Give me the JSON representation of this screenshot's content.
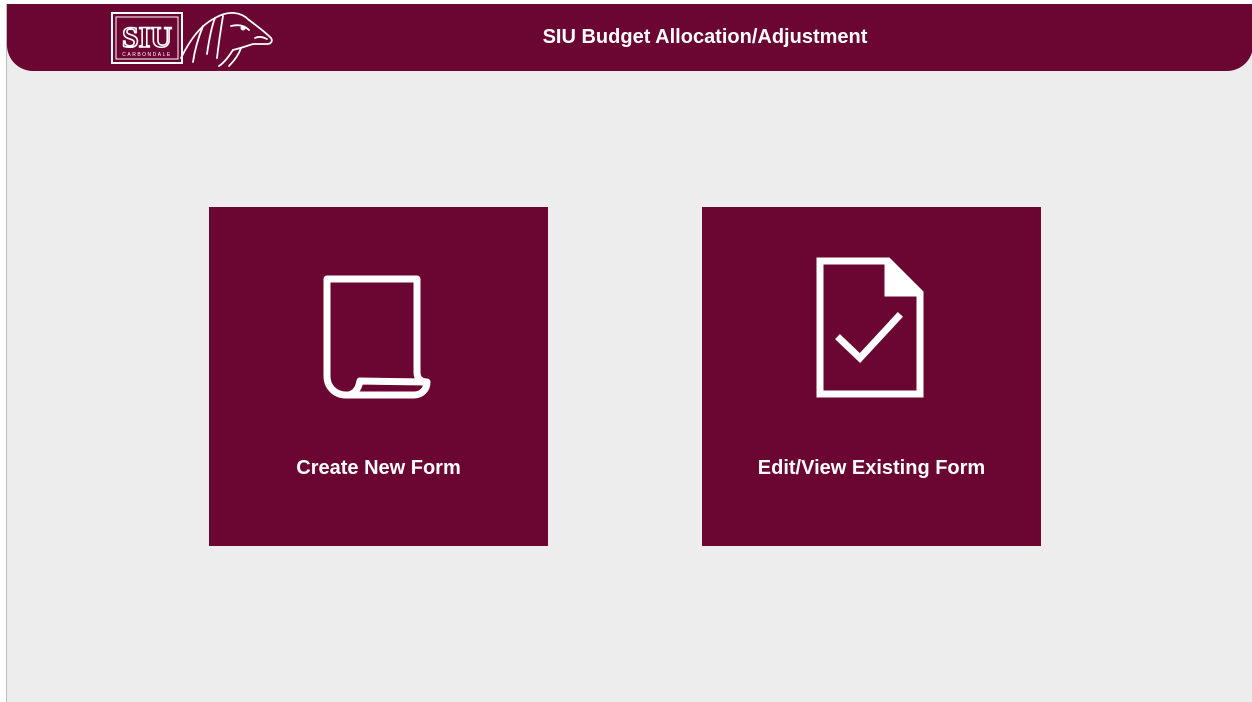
{
  "header": {
    "title": "SIU Budget Allocation/Adjustment",
    "logo": {
      "text": "SIU",
      "subtext": "CARBONDALE",
      "icon": "saluki-dog-head"
    },
    "background_color": "#6b0633"
  },
  "tiles": [
    {
      "label": "Create New Form",
      "icon": "blank-document-icon"
    },
    {
      "label": "Edit/View Existing Form",
      "icon": "document-checkmark-icon"
    }
  ],
  "colors": {
    "brand_maroon": "#6b0633",
    "page_background": "#ededed",
    "text_on_brand": "#ffffff"
  }
}
